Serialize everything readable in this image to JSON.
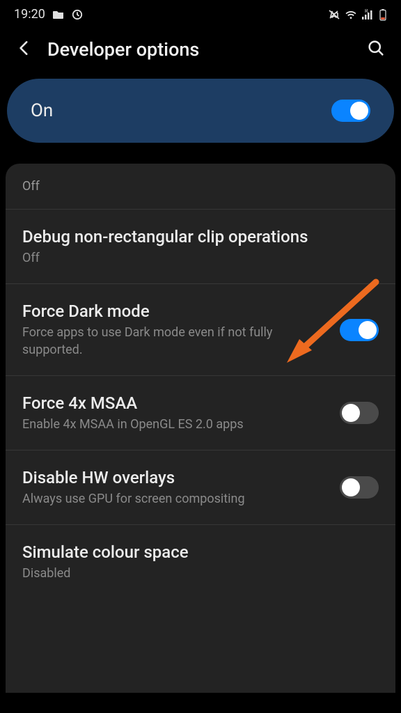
{
  "statusbar": {
    "time": "19:20"
  },
  "header": {
    "title": "Developer options"
  },
  "master": {
    "label": "On",
    "state": true
  },
  "partial": {
    "status": "Off"
  },
  "settings": [
    {
      "title": "Debug non-rectangular clip operations",
      "subtitle": "Off",
      "toggle": null
    },
    {
      "title": "Force Dark mode",
      "subtitle": "Force apps to use Dark mode even if not fully supported.",
      "toggle": true
    },
    {
      "title": "Force 4x MSAA",
      "subtitle": "Enable 4x MSAA in OpenGL ES 2.0 apps",
      "toggle": false
    },
    {
      "title": "Disable HW overlays",
      "subtitle": "Always use GPU for screen compositing",
      "toggle": false
    },
    {
      "title": "Simulate colour space",
      "subtitle": "Disabled",
      "toggle": null
    }
  ]
}
